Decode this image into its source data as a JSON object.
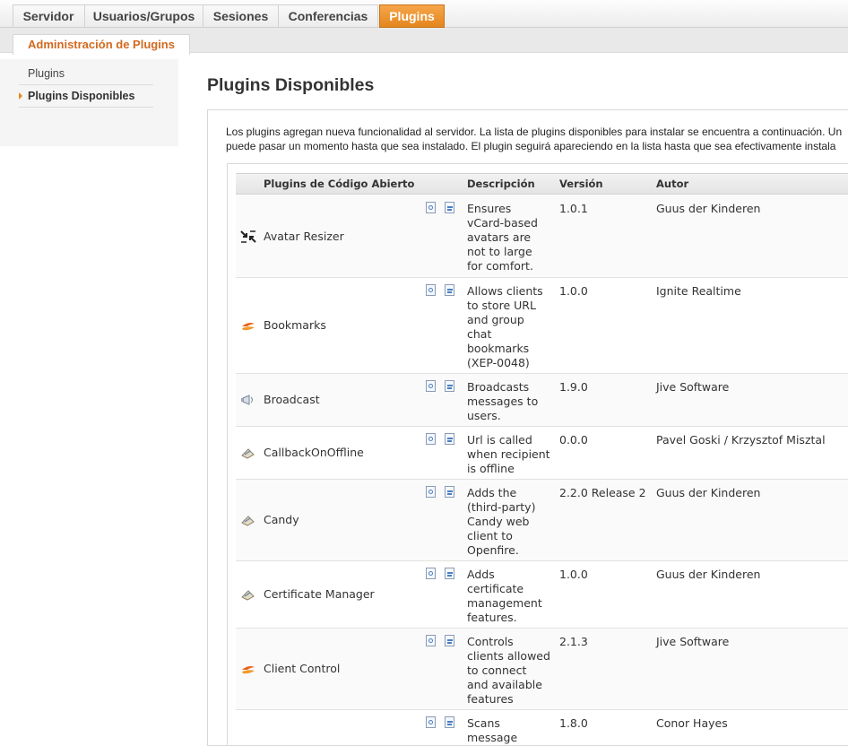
{
  "tabs": [
    {
      "label": "Servidor",
      "active": false
    },
    {
      "label": "Usuarios/Grupos",
      "active": false
    },
    {
      "label": "Sesiones",
      "active": false
    },
    {
      "label": "Conferencias",
      "active": false
    },
    {
      "label": "Plugins",
      "active": true
    }
  ],
  "subtab": {
    "label": "Administración de Plugins"
  },
  "sidebar": {
    "items": [
      {
        "label": "Plugins",
        "active": false
      },
      {
        "label": "Plugins Disponibles",
        "active": true
      }
    ]
  },
  "page": {
    "title": "Plugins Disponibles",
    "intro_line1": "Los plugins agregan nueva funcionalidad al servidor. La lista de plugins disponibles para instalar se encuentra a continuación. Un",
    "intro_line2": "puede pasar un momento hasta que sea instalado. El plugin seguirá apareciendo en la lista hasta que sea efectivamente instala"
  },
  "table": {
    "headers": {
      "name": "Plugins de Código Abierto",
      "description": "Descripción",
      "version": "Versión",
      "author": "Autor"
    },
    "rows": [
      {
        "name": "Avatar Resizer",
        "icon": "resize-arrows-icon",
        "description": [
          "Ensures",
          "vCard-based",
          "avatars are",
          "not to large",
          "for comfort."
        ],
        "version": "1.0.1",
        "author": "Guus der Kinderen"
      },
      {
        "name": "Bookmarks",
        "icon": "openfire-flame-icon",
        "description": [
          "Allows clients",
          "to store URL",
          "and group",
          "chat",
          "bookmarks",
          "(XEP-0048)"
        ],
        "version": "1.0.0",
        "author": "Ignite Realtime"
      },
      {
        "name": "Broadcast",
        "icon": "megaphone-icon",
        "description": [
          "Broadcasts",
          "messages to",
          "users."
        ],
        "version": "1.9.0",
        "author": "Jive Software"
      },
      {
        "name": "CallbackOnOffline",
        "icon": "plugin-plug-icon",
        "description": [
          "Url is called",
          "when recipient",
          "is offline"
        ],
        "version": "0.0.0",
        "author": "Pavel Goski / Krzysztof Misztal"
      },
      {
        "name": "Candy",
        "icon": "plugin-plug-icon",
        "description": [
          "Adds the",
          "(third-party)",
          "Candy web",
          "client to",
          "Openfire."
        ],
        "version": "2.2.0 Release 2",
        "author": "Guus der Kinderen"
      },
      {
        "name": "Certificate Manager",
        "icon": "plugin-plug-icon",
        "description": [
          "Adds",
          "certificate",
          "management",
          "features."
        ],
        "version": "1.0.0",
        "author": "Guus der Kinderen"
      },
      {
        "name": "Client Control",
        "icon": "openfire-flame-icon",
        "description": [
          "Controls",
          "clients allowed",
          "to connect",
          "and available",
          "features"
        ],
        "version": "2.1.3",
        "author": "Jive Software"
      },
      {
        "name": "",
        "icon": "",
        "description": [
          "Scans",
          "message"
        ],
        "version": "1.8.0",
        "author": "Conor Hayes"
      }
    ]
  }
}
